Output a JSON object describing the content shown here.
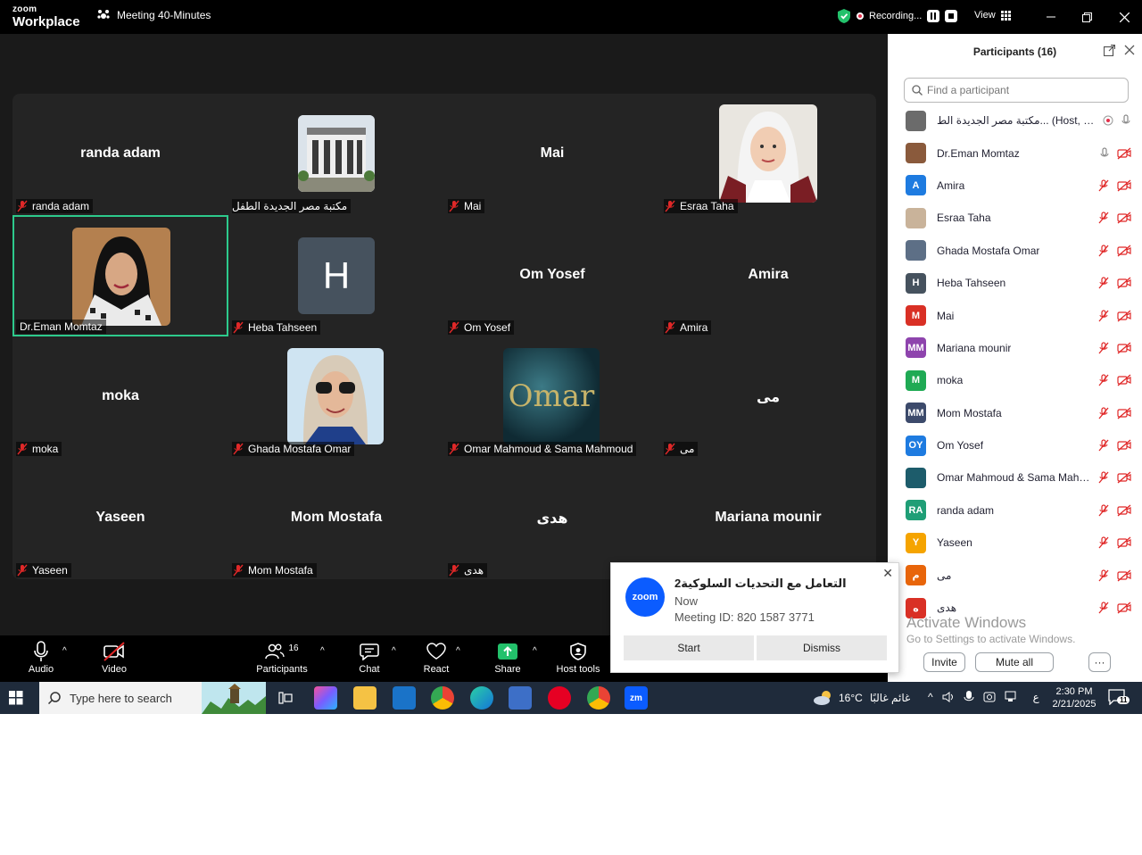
{
  "titlebar": {
    "brand_top": "zoom",
    "brand_bottom": "Workplace",
    "meeting_title": "Meeting 40-Minutes",
    "recording_label": "Recording...",
    "view_label": "View"
  },
  "tiles": [
    {
      "center": "randa adam",
      "label": "randa adam"
    },
    {
      "center": "",
      "label": "مكتبة مصر الجديدة الطفل"
    },
    {
      "center": "Mai",
      "label": "Mai"
    },
    {
      "center": "",
      "label": "Esraa Taha"
    },
    {
      "center": "",
      "label": "Dr.Eman Momtaz"
    },
    {
      "center": "",
      "label": "Heba Tahseen",
      "letter": "H"
    },
    {
      "center": "Om Yosef",
      "label": "Om Yosef"
    },
    {
      "center": "Amira",
      "label": "Amira"
    },
    {
      "center": "moka",
      "label": "moka"
    },
    {
      "center": "",
      "label": "Ghada Mostafa Omar"
    },
    {
      "center": "",
      "label": "Omar Mahmoud & Sama Mahmoud",
      "image_text": "Omar"
    },
    {
      "center": "مى",
      "label": "مى"
    },
    {
      "center": "Yaseen",
      "label": "Yaseen"
    },
    {
      "center": "Mom Mostafa",
      "label": "Mom Mostafa"
    },
    {
      "center": "هدى",
      "label": "هدى"
    },
    {
      "center": "Mariana mounir",
      "label": ""
    }
  ],
  "panel": {
    "title": "Participants (16)",
    "search_placeholder": "Find a participant",
    "participants": [
      {
        "name": "مكتبة مصر الجديدة الط... (Host, me)",
        "avatar": "",
        "color": "#6b6b6b"
      },
      {
        "name": "Dr.Eman Momtaz",
        "avatar": "",
        "color": "#8a5a3c"
      },
      {
        "name": "Amira",
        "avatar": "A",
        "color": "#1e7be0"
      },
      {
        "name": "Esraa Taha",
        "avatar": "",
        "color": "#c9b39a"
      },
      {
        "name": "Ghada Mostafa Omar",
        "avatar": "",
        "color": "#5d6f86"
      },
      {
        "name": "Heba Tahseen",
        "avatar": "H",
        "color": "#46525e"
      },
      {
        "name": "Mai",
        "avatar": "M",
        "color": "#d93025"
      },
      {
        "name": "Mariana mounir",
        "avatar": "MM",
        "color": "#8e44ad"
      },
      {
        "name": "moka",
        "avatar": "M",
        "color": "#1faa54"
      },
      {
        "name": "Mom Mostafa",
        "avatar": "MM",
        "color": "#3c4a6b"
      },
      {
        "name": "Om Yosef",
        "avatar": "OY",
        "color": "#1e7be0"
      },
      {
        "name": "Omar Mahmoud & Sama Mahm...",
        "avatar": "",
        "color": "#1d5c6b"
      },
      {
        "name": "randa adam",
        "avatar": "RA",
        "color": "#1f9e76"
      },
      {
        "name": "Yaseen",
        "avatar": "Y",
        "color": "#f5a400"
      },
      {
        "name": "مى",
        "avatar": "م",
        "color": "#e8650a"
      },
      {
        "name": "هدى",
        "avatar": "ه",
        "color": "#d93025"
      }
    ],
    "activate_line1": "Activate Windows",
    "activate_line2": "Go to Settings to activate Windows.",
    "invite_label": "Invite",
    "mute_all_label": "Mute all",
    "more_label": "···"
  },
  "toolbar": {
    "audio": "Audio",
    "video": "Video",
    "participants": "Participants",
    "participants_count": "16",
    "chat": "Chat",
    "react": "React",
    "share": "Share",
    "host_tools": "Host tools"
  },
  "notification": {
    "title": "التعامل مع التحديات السلوكية2",
    "time": "Now",
    "meeting_id": "Meeting ID: 820 1587 3771",
    "start": "Start",
    "dismiss": "Dismiss",
    "logo": "zoom"
  },
  "taskbar": {
    "search_placeholder": "Type here to search",
    "weather_temp": "16°C",
    "weather_desc": "غائم غالبًا",
    "lang": "ع",
    "time": "2:30 PM",
    "date": "2/21/2025",
    "notif_count": "11"
  }
}
